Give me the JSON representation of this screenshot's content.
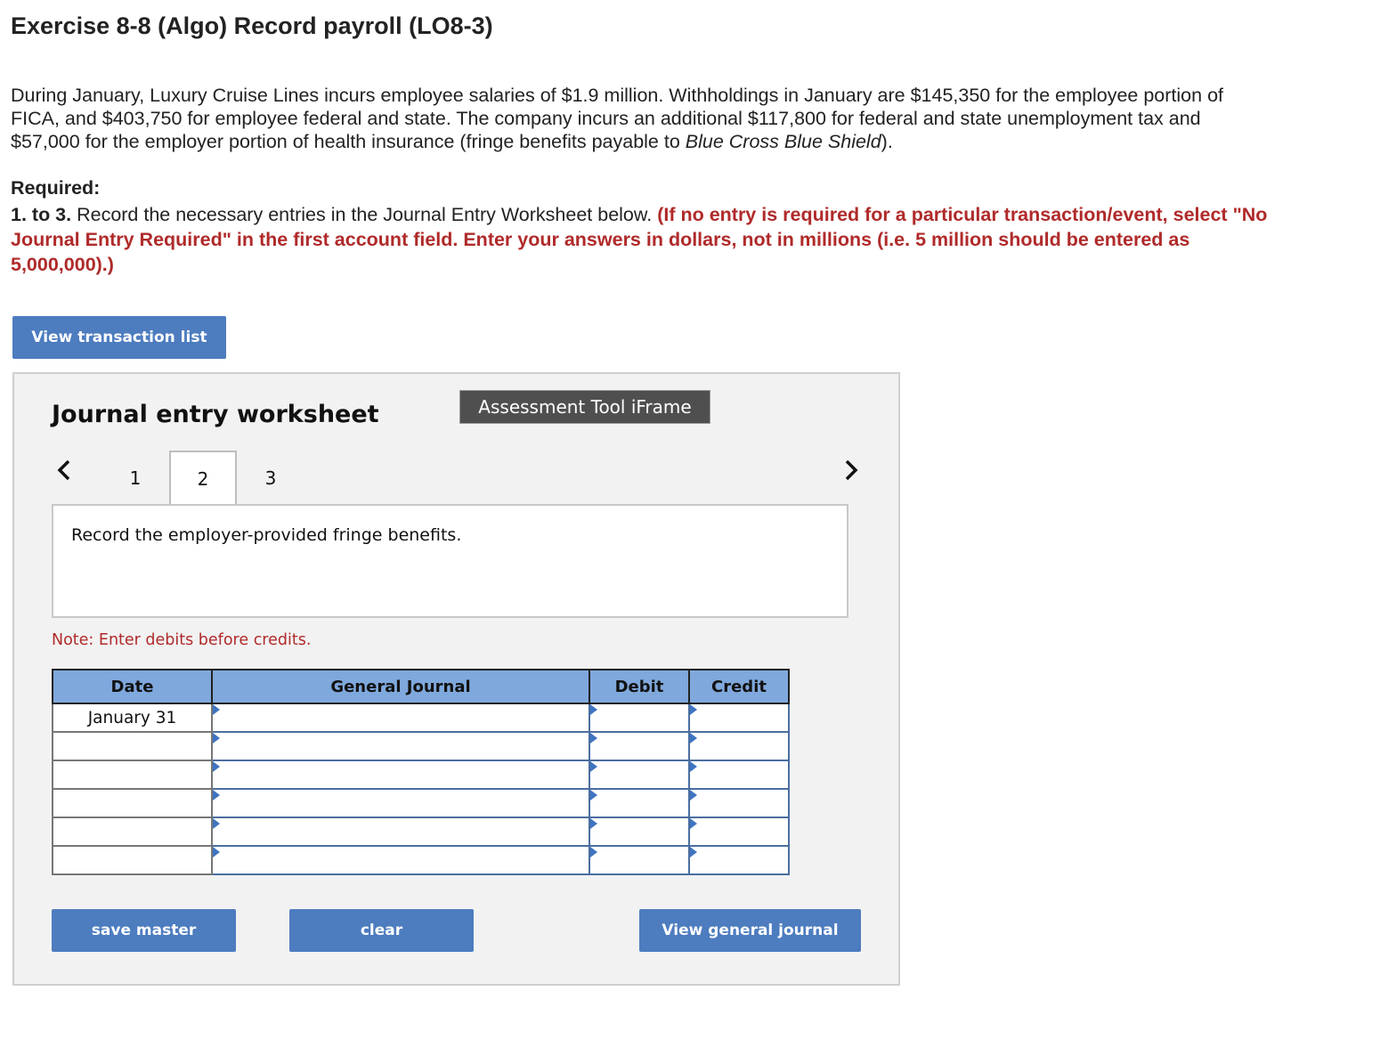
{
  "header": {
    "title": "Exercise 8-8 (Algo) Record payroll (LO8-3)"
  },
  "intro": {
    "text_before_italic": "During January, Luxury Cruise Lines incurs employee salaries of $1.9 million. Withholdings in January are $145,350 for the employee portion of FICA, and $403,750 for employee federal and state. The company incurs an additional $117,800 for federal and state unemployment tax and $57,000 for the employer portion of health insurance (fringe benefits payable to ",
    "italic": "Blue Cross Blue Shield",
    "text_after_italic": ")."
  },
  "required": {
    "heading": "Required:",
    "number": "1. to 3.",
    "instruction": " Record the necessary entries in the Journal Entry Worksheet below. ",
    "red_note": "(If no entry is required for a particular transaction/event, select \"No Journal Entry Required\" in the first account field. Enter your answers in dollars, not in millions (i.e. 5 million should be entered as 5,000,000).)"
  },
  "buttons": {
    "view_transactions": "View transaction list",
    "save_master": "save master",
    "clear": "clear",
    "view_general_journal": "View general journal"
  },
  "worksheet": {
    "title": "Journal entry worksheet",
    "iframe_label": "Assessment Tool iFrame",
    "tabs": [
      "1",
      "2",
      "3"
    ],
    "active_tab": "2",
    "prompt": "Record the employer-provided fringe benefits.",
    "note": "Note: Enter debits before credits.",
    "table": {
      "headers": [
        "Date",
        "General Journal",
        "Debit",
        "Credit"
      ],
      "rows": [
        {
          "date": "January 31",
          "account": "",
          "debit": "",
          "credit": ""
        },
        {
          "date": "",
          "account": "",
          "debit": "",
          "credit": ""
        },
        {
          "date": "",
          "account": "",
          "debit": "",
          "credit": ""
        },
        {
          "date": "",
          "account": "",
          "debit": "",
          "credit": ""
        },
        {
          "date": "",
          "account": "",
          "debit": "",
          "credit": ""
        },
        {
          "date": "",
          "account": "",
          "debit": "",
          "credit": ""
        }
      ]
    }
  },
  "icons": {
    "prev": "chevron-left-icon",
    "next": "chevron-right-icon"
  },
  "colors": {
    "button_blue": "#4d7cbf",
    "header_blue": "#7fa8dc",
    "instruction_red": "#b02a2a",
    "panel_gray": "#f2f2f2"
  }
}
